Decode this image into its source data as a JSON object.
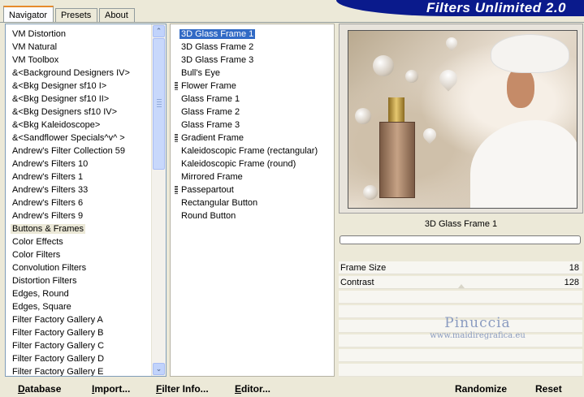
{
  "app": {
    "banner_title": "Filters Unlimited 2.0"
  },
  "tabs": [
    {
      "label": "Navigator",
      "active": true
    },
    {
      "label": "Presets",
      "active": false
    },
    {
      "label": "About",
      "active": false
    }
  ],
  "categories": {
    "items": [
      "VM Distortion",
      "VM Natural",
      "VM Toolbox",
      "&<Background Designers IV>",
      "&<Bkg Designer sf10 I>",
      "&<Bkg Designer sf10 II>",
      "&<Bkg Designers sf10 IV>",
      "&<Bkg Kaleidoscope>",
      "&<Sandflower Specials^v^ >",
      "Andrew's Filter Collection 59",
      "Andrew's Filters 10",
      "Andrew's Filters 1",
      "Andrew's Filters 33",
      "Andrew's Filters 6",
      "Andrew's Filters 9",
      "Buttons & Frames",
      "Color Effects",
      "Color Filters",
      "Convolution Filters",
      "Distortion Filters",
      "Edges, Round",
      "Edges, Square",
      "Filter Factory Gallery A",
      "Filter Factory Gallery B",
      "Filter Factory Gallery C",
      "Filter Factory Gallery D",
      "Filter Factory Gallery E"
    ],
    "selected": "Buttons & Frames",
    "scroll_up_glyph": "⌃",
    "scroll_down_glyph": "⌄"
  },
  "filters": {
    "items": [
      {
        "label": "3D Glass Frame 1",
        "selected": true,
        "marked": false
      },
      {
        "label": "3D Glass Frame 2",
        "selected": false,
        "marked": false
      },
      {
        "label": "3D Glass Frame 3",
        "selected": false,
        "marked": false
      },
      {
        "label": "Bull's Eye",
        "selected": false,
        "marked": false
      },
      {
        "label": "Flower Frame",
        "selected": false,
        "marked": true
      },
      {
        "label": "Glass Frame 1",
        "selected": false,
        "marked": false
      },
      {
        "label": "Glass Frame 2",
        "selected": false,
        "marked": false
      },
      {
        "label": "Glass Frame 3",
        "selected": false,
        "marked": false
      },
      {
        "label": "Gradient Frame",
        "selected": false,
        "marked": true
      },
      {
        "label": "Kaleidoscopic Frame (rectangular)",
        "selected": false,
        "marked": false
      },
      {
        "label": "Kaleidoscopic Frame (round)",
        "selected": false,
        "marked": false
      },
      {
        "label": "Mirrored Frame",
        "selected": false,
        "marked": false
      },
      {
        "label": "Passepartout",
        "selected": false,
        "marked": true
      },
      {
        "label": "Rectangular Button",
        "selected": false,
        "marked": false
      },
      {
        "label": "Round Button",
        "selected": false,
        "marked": false
      }
    ]
  },
  "preview": {
    "filter_name": "3D Glass Frame 1",
    "progress": 0
  },
  "parameters": [
    {
      "label": "Frame Size",
      "value": "18"
    },
    {
      "label": "Contrast",
      "value": "128"
    }
  ],
  "watermark": {
    "name": "Pinuccia",
    "site": "www.maidiregrafica.eu"
  },
  "buttons": {
    "database": {
      "first": "D",
      "rest": "atabase"
    },
    "import": {
      "first": "I",
      "rest": "mport..."
    },
    "filter_info": {
      "first": "F",
      "rest": "ilter Info..."
    },
    "editor": {
      "first": "E",
      "rest": "ditor..."
    },
    "randomize": "Randomize",
    "reset": "Reset"
  },
  "colors": {
    "banner": "#0a1a8c",
    "selection": "#316ac5",
    "window_bg": "#ece9d8",
    "tab_accent": "#e68b2c"
  }
}
